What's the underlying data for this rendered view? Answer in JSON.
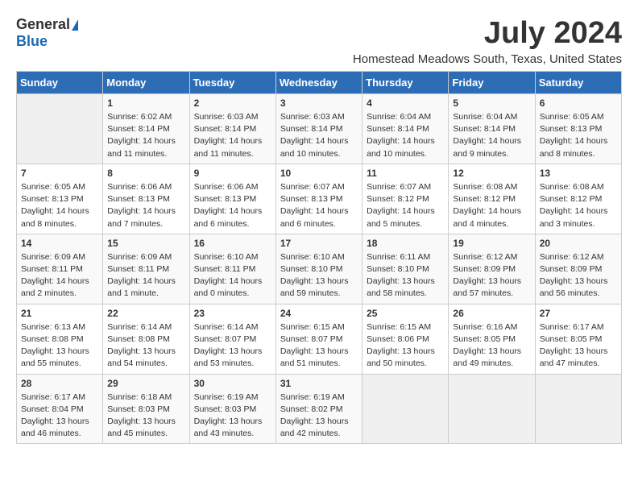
{
  "logo": {
    "general": "General",
    "blue": "Blue"
  },
  "title": "July 2024",
  "location": "Homestead Meadows South, Texas, United States",
  "days_of_week": [
    "Sunday",
    "Monday",
    "Tuesday",
    "Wednesday",
    "Thursday",
    "Friday",
    "Saturday"
  ],
  "weeks": [
    [
      {
        "day": "",
        "info": ""
      },
      {
        "day": "1",
        "info": "Sunrise: 6:02 AM\nSunset: 8:14 PM\nDaylight: 14 hours\nand 11 minutes."
      },
      {
        "day": "2",
        "info": "Sunrise: 6:03 AM\nSunset: 8:14 PM\nDaylight: 14 hours\nand 11 minutes."
      },
      {
        "day": "3",
        "info": "Sunrise: 6:03 AM\nSunset: 8:14 PM\nDaylight: 14 hours\nand 10 minutes."
      },
      {
        "day": "4",
        "info": "Sunrise: 6:04 AM\nSunset: 8:14 PM\nDaylight: 14 hours\nand 10 minutes."
      },
      {
        "day": "5",
        "info": "Sunrise: 6:04 AM\nSunset: 8:14 PM\nDaylight: 14 hours\nand 9 minutes."
      },
      {
        "day": "6",
        "info": "Sunrise: 6:05 AM\nSunset: 8:13 PM\nDaylight: 14 hours\nand 8 minutes."
      }
    ],
    [
      {
        "day": "7",
        "info": "Sunrise: 6:05 AM\nSunset: 8:13 PM\nDaylight: 14 hours\nand 8 minutes."
      },
      {
        "day": "8",
        "info": "Sunrise: 6:06 AM\nSunset: 8:13 PM\nDaylight: 14 hours\nand 7 minutes."
      },
      {
        "day": "9",
        "info": "Sunrise: 6:06 AM\nSunset: 8:13 PM\nDaylight: 14 hours\nand 6 minutes."
      },
      {
        "day": "10",
        "info": "Sunrise: 6:07 AM\nSunset: 8:13 PM\nDaylight: 14 hours\nand 6 minutes."
      },
      {
        "day": "11",
        "info": "Sunrise: 6:07 AM\nSunset: 8:12 PM\nDaylight: 14 hours\nand 5 minutes."
      },
      {
        "day": "12",
        "info": "Sunrise: 6:08 AM\nSunset: 8:12 PM\nDaylight: 14 hours\nand 4 minutes."
      },
      {
        "day": "13",
        "info": "Sunrise: 6:08 AM\nSunset: 8:12 PM\nDaylight: 14 hours\nand 3 minutes."
      }
    ],
    [
      {
        "day": "14",
        "info": "Sunrise: 6:09 AM\nSunset: 8:11 PM\nDaylight: 14 hours\nand 2 minutes."
      },
      {
        "day": "15",
        "info": "Sunrise: 6:09 AM\nSunset: 8:11 PM\nDaylight: 14 hours\nand 1 minute."
      },
      {
        "day": "16",
        "info": "Sunrise: 6:10 AM\nSunset: 8:11 PM\nDaylight: 14 hours\nand 0 minutes."
      },
      {
        "day": "17",
        "info": "Sunrise: 6:10 AM\nSunset: 8:10 PM\nDaylight: 13 hours\nand 59 minutes."
      },
      {
        "day": "18",
        "info": "Sunrise: 6:11 AM\nSunset: 8:10 PM\nDaylight: 13 hours\nand 58 minutes."
      },
      {
        "day": "19",
        "info": "Sunrise: 6:12 AM\nSunset: 8:09 PM\nDaylight: 13 hours\nand 57 minutes."
      },
      {
        "day": "20",
        "info": "Sunrise: 6:12 AM\nSunset: 8:09 PM\nDaylight: 13 hours\nand 56 minutes."
      }
    ],
    [
      {
        "day": "21",
        "info": "Sunrise: 6:13 AM\nSunset: 8:08 PM\nDaylight: 13 hours\nand 55 minutes."
      },
      {
        "day": "22",
        "info": "Sunrise: 6:14 AM\nSunset: 8:08 PM\nDaylight: 13 hours\nand 54 minutes."
      },
      {
        "day": "23",
        "info": "Sunrise: 6:14 AM\nSunset: 8:07 PM\nDaylight: 13 hours\nand 53 minutes."
      },
      {
        "day": "24",
        "info": "Sunrise: 6:15 AM\nSunset: 8:07 PM\nDaylight: 13 hours\nand 51 minutes."
      },
      {
        "day": "25",
        "info": "Sunrise: 6:15 AM\nSunset: 8:06 PM\nDaylight: 13 hours\nand 50 minutes."
      },
      {
        "day": "26",
        "info": "Sunrise: 6:16 AM\nSunset: 8:05 PM\nDaylight: 13 hours\nand 49 minutes."
      },
      {
        "day": "27",
        "info": "Sunrise: 6:17 AM\nSunset: 8:05 PM\nDaylight: 13 hours\nand 47 minutes."
      }
    ],
    [
      {
        "day": "28",
        "info": "Sunrise: 6:17 AM\nSunset: 8:04 PM\nDaylight: 13 hours\nand 46 minutes."
      },
      {
        "day": "29",
        "info": "Sunrise: 6:18 AM\nSunset: 8:03 PM\nDaylight: 13 hours\nand 45 minutes."
      },
      {
        "day": "30",
        "info": "Sunrise: 6:19 AM\nSunset: 8:03 PM\nDaylight: 13 hours\nand 43 minutes."
      },
      {
        "day": "31",
        "info": "Sunrise: 6:19 AM\nSunset: 8:02 PM\nDaylight: 13 hours\nand 42 minutes."
      },
      {
        "day": "",
        "info": ""
      },
      {
        "day": "",
        "info": ""
      },
      {
        "day": "",
        "info": ""
      }
    ]
  ]
}
